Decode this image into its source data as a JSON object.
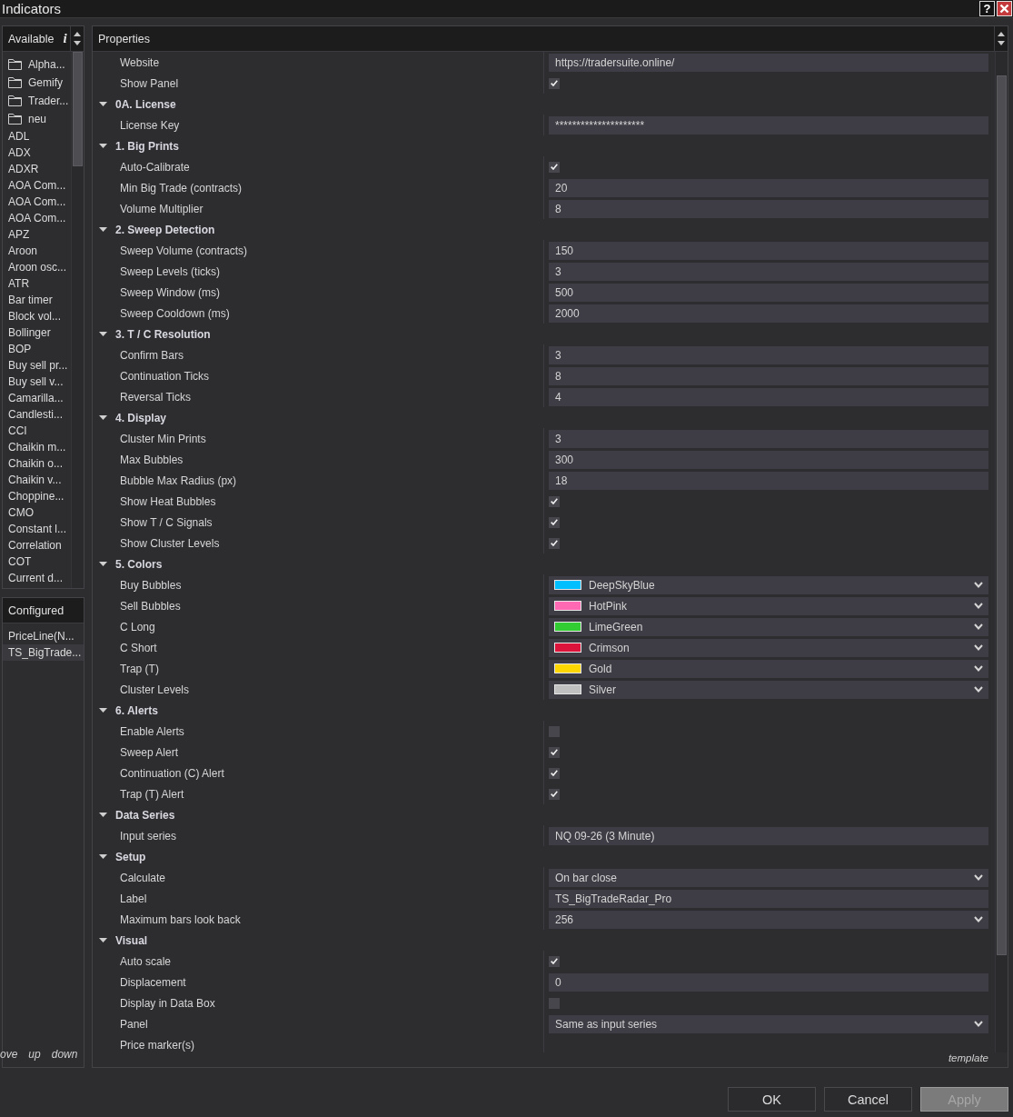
{
  "window": {
    "title": "Indicators",
    "help_button": "?"
  },
  "available": {
    "header": "Available",
    "info_glyph": "i",
    "items": [
      {
        "kind": "folder",
        "label": "Alpha...",
        "selected": false
      },
      {
        "kind": "folder",
        "label": "Gemify",
        "selected": false
      },
      {
        "kind": "folder",
        "label": "Trader...",
        "selected": false
      },
      {
        "kind": "folder",
        "label": "neu",
        "selected": false
      },
      {
        "kind": "indicator",
        "label": "ADL",
        "selected": false
      },
      {
        "kind": "indicator",
        "label": "ADX",
        "selected": false
      },
      {
        "kind": "indicator",
        "label": "ADXR",
        "selected": false
      },
      {
        "kind": "indicator",
        "label": "AOA Com...",
        "selected": false
      },
      {
        "kind": "indicator",
        "label": "AOA Com...",
        "selected": false
      },
      {
        "kind": "indicator",
        "label": "AOA Com...",
        "selected": false
      },
      {
        "kind": "indicator",
        "label": "APZ",
        "selected": false
      },
      {
        "kind": "indicator",
        "label": "Aroon",
        "selected": false
      },
      {
        "kind": "indicator",
        "label": "Aroon osc...",
        "selected": false
      },
      {
        "kind": "indicator",
        "label": "ATR",
        "selected": false
      },
      {
        "kind": "indicator",
        "label": "Bar timer",
        "selected": false
      },
      {
        "kind": "indicator",
        "label": "Block vol...",
        "selected": false
      },
      {
        "kind": "indicator",
        "label": "Bollinger",
        "selected": false
      },
      {
        "kind": "indicator",
        "label": "BOP",
        "selected": false
      },
      {
        "kind": "indicator",
        "label": "Buy sell pr...",
        "selected": false
      },
      {
        "kind": "indicator",
        "label": "Buy sell v...",
        "selected": false
      },
      {
        "kind": "indicator",
        "label": "Camarilla...",
        "selected": false
      },
      {
        "kind": "indicator",
        "label": "Candlesti...",
        "selected": false
      },
      {
        "kind": "indicator",
        "label": "CCI",
        "selected": false
      },
      {
        "kind": "indicator",
        "label": "Chaikin m...",
        "selected": false
      },
      {
        "kind": "indicator",
        "label": "Chaikin o...",
        "selected": false
      },
      {
        "kind": "indicator",
        "label": "Chaikin v...",
        "selected": false
      },
      {
        "kind": "indicator",
        "label": "Choppine...",
        "selected": false
      },
      {
        "kind": "indicator",
        "label": "CMO",
        "selected": false
      },
      {
        "kind": "indicator",
        "label": "Constant l...",
        "selected": false
      },
      {
        "kind": "indicator",
        "label": "Correlation",
        "selected": false
      },
      {
        "kind": "indicator",
        "label": "COT",
        "selected": false
      },
      {
        "kind": "indicator",
        "label": "Current d...",
        "selected": false
      }
    ]
  },
  "configured": {
    "header": "Configured",
    "items": [
      {
        "label": "PriceLine(N...",
        "selected": false
      },
      {
        "label": "TS_BigTrade...",
        "selected": true
      }
    ],
    "actions": [
      "ove",
      "up",
      "down"
    ]
  },
  "properties": {
    "header": "Properties",
    "groups": [
      {
        "rows": [
          {
            "label": "Website",
            "kind": "text",
            "value": "https://tradersuite.online/"
          },
          {
            "label": "Show Panel",
            "kind": "check",
            "checked": true
          }
        ]
      },
      {
        "title": "0A. License",
        "expanded": true,
        "rows": [
          {
            "label": "License Key",
            "kind": "text",
            "value": "*********************"
          }
        ]
      },
      {
        "title": "1. Big Prints",
        "expanded": true,
        "rows": [
          {
            "label": "Auto-Calibrate",
            "kind": "check",
            "checked": true
          },
          {
            "label": "Min Big Trade (contracts)",
            "kind": "text",
            "value": "20"
          },
          {
            "label": "Volume Multiplier",
            "kind": "text",
            "value": "8"
          }
        ]
      },
      {
        "title": "2. Sweep Detection",
        "expanded": true,
        "rows": [
          {
            "label": "Sweep Volume (contracts)",
            "kind": "text",
            "value": "150"
          },
          {
            "label": "Sweep Levels (ticks)",
            "kind": "text",
            "value": "3"
          },
          {
            "label": "Sweep Window (ms)",
            "kind": "text",
            "value": "500"
          },
          {
            "label": "Sweep Cooldown (ms)",
            "kind": "text",
            "value": "2000"
          }
        ]
      },
      {
        "title": "3. T / C Resolution",
        "expanded": true,
        "rows": [
          {
            "label": "Confirm Bars",
            "kind": "text",
            "value": "3"
          },
          {
            "label": "Continuation Ticks",
            "kind": "text",
            "value": "8"
          },
          {
            "label": "Reversal Ticks",
            "kind": "text",
            "value": "4"
          }
        ]
      },
      {
        "title": "4. Display",
        "expanded": true,
        "rows": [
          {
            "label": "Cluster Min Prints",
            "kind": "text",
            "value": "3"
          },
          {
            "label": "Max Bubbles",
            "kind": "text",
            "value": "300"
          },
          {
            "label": "Bubble Max Radius (px)",
            "kind": "text",
            "value": "18"
          },
          {
            "label": "Show Heat Bubbles",
            "kind": "check",
            "checked": true
          },
          {
            "label": "Show T / C Signals",
            "kind": "check",
            "checked": true
          },
          {
            "label": "Show Cluster Levels",
            "kind": "check",
            "checked": true
          }
        ]
      },
      {
        "title": "5. Colors",
        "expanded": true,
        "rows": [
          {
            "label": "Buy Bubbles",
            "kind": "color",
            "value": "DeepSkyBlue",
            "color": "#00bfff"
          },
          {
            "label": "Sell Bubbles",
            "kind": "color",
            "value": "HotPink",
            "color": "#ff69b4"
          },
          {
            "label": "C Long",
            "kind": "color",
            "value": "LimeGreen",
            "color": "#32cd32"
          },
          {
            "label": "C Short",
            "kind": "color",
            "value": "Crimson",
            "color": "#dc143c"
          },
          {
            "label": "Trap (T)",
            "kind": "color",
            "value": "Gold",
            "color": "#ffd700"
          },
          {
            "label": "Cluster Levels",
            "kind": "color",
            "value": "Silver",
            "color": "#c0c0c0"
          }
        ]
      },
      {
        "title": "6. Alerts",
        "expanded": true,
        "rows": [
          {
            "label": "Enable Alerts",
            "kind": "check",
            "checked": false
          },
          {
            "label": "Sweep Alert",
            "kind": "check",
            "checked": true
          },
          {
            "label": "Continuation (C) Alert",
            "kind": "check",
            "checked": true
          },
          {
            "label": "Trap (T) Alert",
            "kind": "check",
            "checked": true
          }
        ]
      },
      {
        "title": "Data Series",
        "expanded": true,
        "rows": [
          {
            "label": "Input series",
            "kind": "text",
            "value": "NQ 09-26 (3 Minute)"
          }
        ]
      },
      {
        "title": "Setup",
        "expanded": true,
        "rows": [
          {
            "label": "Calculate",
            "kind": "select",
            "value": "On bar close"
          },
          {
            "label": "Label",
            "kind": "text",
            "value": "TS_BigTradeRadar_Pro"
          },
          {
            "label": "Maximum bars look back",
            "kind": "select",
            "value": "256"
          }
        ]
      },
      {
        "title": "Visual",
        "expanded": true,
        "rows": [
          {
            "label": "Auto scale",
            "kind": "check",
            "checked": true
          },
          {
            "label": "Displacement",
            "kind": "text",
            "value": "0"
          },
          {
            "label": "Display in Data Box",
            "kind": "check",
            "checked": false
          },
          {
            "label": "Panel",
            "kind": "select",
            "value": "Same as input series"
          },
          {
            "label": "Price marker(s)",
            "kind": "label"
          }
        ]
      }
    ],
    "footer_link": "template"
  },
  "buttons": [
    {
      "label": "OK",
      "disabled": false
    },
    {
      "label": "Cancel",
      "disabled": false
    },
    {
      "label": "Apply",
      "disabled": true
    }
  ]
}
